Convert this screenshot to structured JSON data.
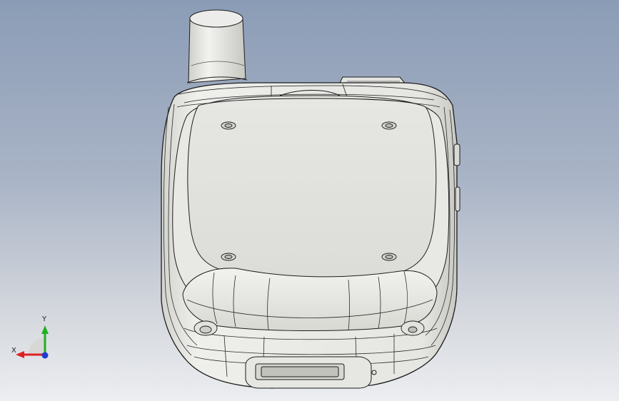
{
  "viewport": {
    "background_top": "#8b9cb6",
    "background_bottom": "#eceef1"
  },
  "model": {
    "description_icon": "handheld-radio-model",
    "face_color": "#ecece9",
    "edge_color": "#1c1c1c"
  },
  "triad": {
    "x_label": "X",
    "y_label": "Y",
    "x_color": "#e02020",
    "y_color": "#20b020",
    "z_color": "#1f3ccf"
  }
}
